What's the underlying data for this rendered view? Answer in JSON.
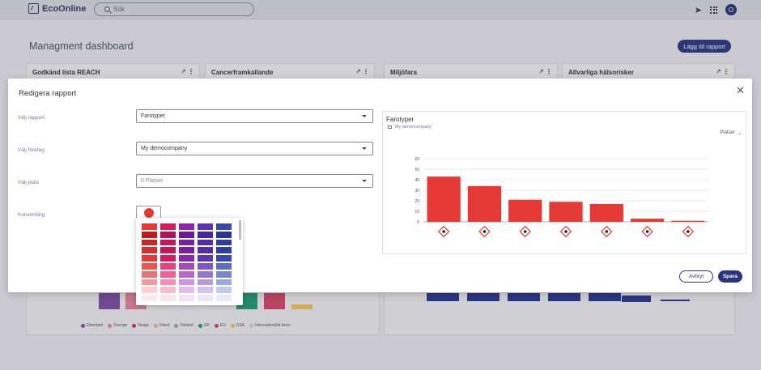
{
  "topbar": {
    "brand": "EcoOnline",
    "search_placeholder": "Sök",
    "avatar_initial": "O"
  },
  "dashboard": {
    "title": "Managment dashboard",
    "add_button": "Lägg till rapport",
    "cards": [
      "Godkänd lista REACH",
      "Cancerframkallande",
      "Miljöfara",
      "Allvarliga hälsorisker"
    ],
    "legend": [
      "Danmark",
      "Sverige",
      "Norge",
      "Irland",
      "Finland",
      "UK",
      "EU",
      "USA",
      "Internationella listor"
    ],
    "legend_colors": [
      "#7b4ea0",
      "#e8829c",
      "#c8344a",
      "#f3b38a",
      "#8cb87a",
      "#1f9c74",
      "#d4456a",
      "#f2c45a",
      "#cfd3dd"
    ]
  },
  "modal": {
    "title": "Redigera rapport",
    "close_icon": "close-icon",
    "fields": [
      {
        "label": "Välj rapport",
        "value": "Farotyper"
      },
      {
        "label": "Välj företag",
        "value": "My democompany"
      },
      {
        "label": "Välj plats",
        "value": "0 Platser"
      },
      {
        "label": "Kolumnfärg",
        "value": ""
      }
    ],
    "selected_color": "#e53935",
    "palette": [
      [
        "#e53935",
        "#d81b60",
        "#8e24aa",
        "#5e35b1",
        "#3949ab"
      ],
      [
        "#b71c1c",
        "#ad1457",
        "#6a1b9a",
        "#4527a0",
        "#283593"
      ],
      [
        "#c62828",
        "#c2185b",
        "#7b1fa2",
        "#512da8",
        "#303f9f"
      ],
      [
        "#d32f2f",
        "#c2185b",
        "#7b1fa2",
        "#512da8",
        "#303f9f"
      ],
      [
        "#e53935",
        "#d81b60",
        "#8e24aa",
        "#5e35b1",
        "#3949ab"
      ],
      [
        "#ef5350",
        "#ec407a",
        "#ab47bc",
        "#7e57c2",
        "#5c6bc0"
      ],
      [
        "#e57373",
        "#f06292",
        "#ba68c8",
        "#9575cd",
        "#7986cb"
      ],
      [
        "#ef9a9a",
        "#f48fb1",
        "#ce93d8",
        "#b39ddb",
        "#9fa8da"
      ],
      [
        "#ffcdd2",
        "#f8bbd0",
        "#e1bee7",
        "#d1c4e9",
        "#c5cae9"
      ],
      [
        "#ffebee",
        "#fce4ec",
        "#f3e5f5",
        "#ede7f6",
        "#e8eaf6"
      ]
    ],
    "preview": {
      "title": "Farotyper",
      "company": "My democompany",
      "places_label": "Platser"
    },
    "cancel_label": "Avbryt",
    "save_label": "Spara"
  },
  "chart_data": {
    "type": "bar",
    "categories": [
      "GHS02 flame",
      "GHS07 exclamation",
      "GHS09 environment",
      "GHS02 flame",
      "GHS08 health hazard",
      "GHS05 corrosion",
      "GHS06 skull"
    ],
    "values": [
      43,
      34,
      21,
      19,
      17,
      3,
      1
    ],
    "ylim": [
      0,
      60
    ],
    "yticks": [
      0,
      10,
      20,
      30,
      40,
      50,
      60
    ],
    "color": "#e53935",
    "grid": true
  }
}
